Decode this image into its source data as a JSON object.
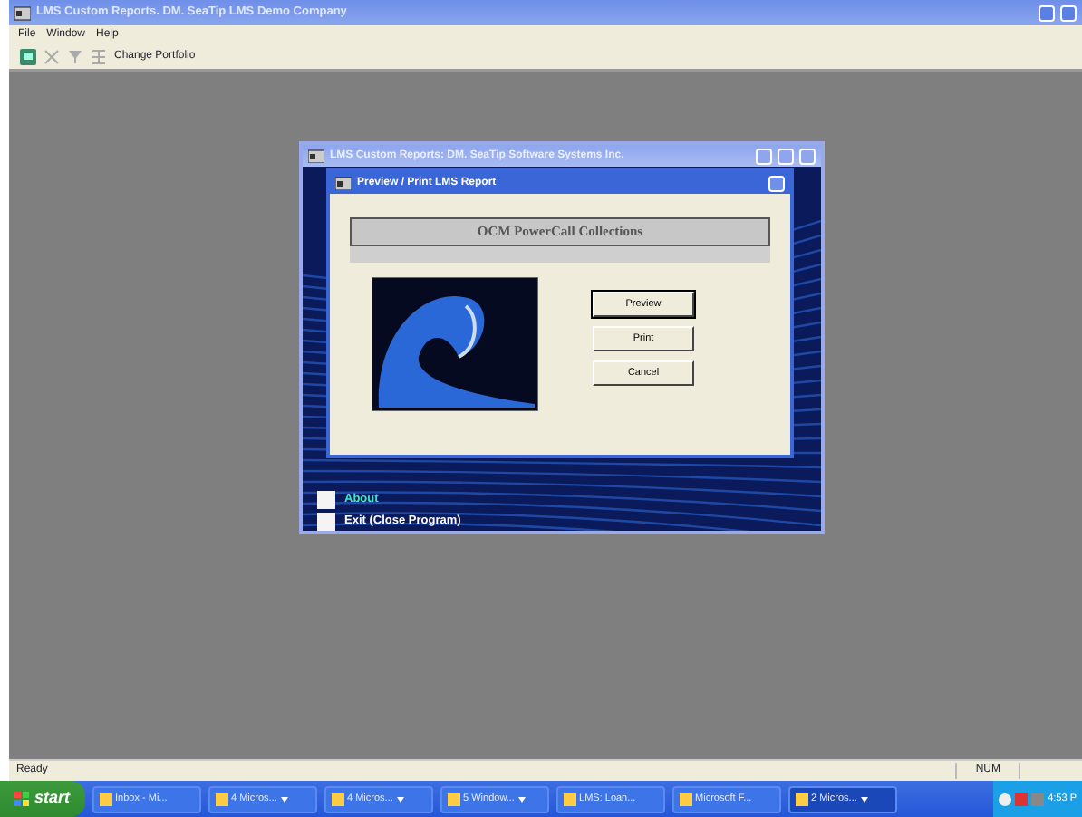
{
  "window": {
    "title": "LMS Custom Reports. DM. SeaTip LMS Demo Company"
  },
  "menu": [
    "File",
    "Window",
    "Help"
  ],
  "toolbar": {
    "label": "Change Portfolio"
  },
  "child_window": {
    "title": "LMS Custom Reports: DM. SeaTip Software Systems Inc.",
    "options": [
      {
        "label": "About",
        "highlighted": true,
        "checked": false
      },
      {
        "label": "Exit (Close Program)",
        "highlighted": false,
        "checked": false
      }
    ]
  },
  "dialog": {
    "title": "Preview / Print LMS Report",
    "report_name": "OCM PowerCall Collections",
    "buttons": [
      {
        "label": "Preview",
        "default": true
      },
      {
        "label": "Print",
        "default": false
      },
      {
        "label": "Cancel",
        "default": false
      }
    ]
  },
  "status_bar": {
    "text": "Ready",
    "num": "NUM"
  },
  "taskbar": {
    "start": "start",
    "items": [
      {
        "label": "Inbox - Mi...",
        "grouped": false,
        "selected": false
      },
      {
        "label": "4 Micros...",
        "grouped": true,
        "selected": false
      },
      {
        "label": "4 Micros...",
        "grouped": true,
        "selected": false
      },
      {
        "label": "5 Window...",
        "grouped": true,
        "selected": false
      },
      {
        "label": "LMS: Loan...",
        "grouped": false,
        "selected": false
      },
      {
        "label": "Microsoft F...",
        "grouped": false,
        "selected": false
      },
      {
        "label": "2 Micros...",
        "grouped": true,
        "selected": true
      }
    ],
    "clock": "4:53 P"
  }
}
